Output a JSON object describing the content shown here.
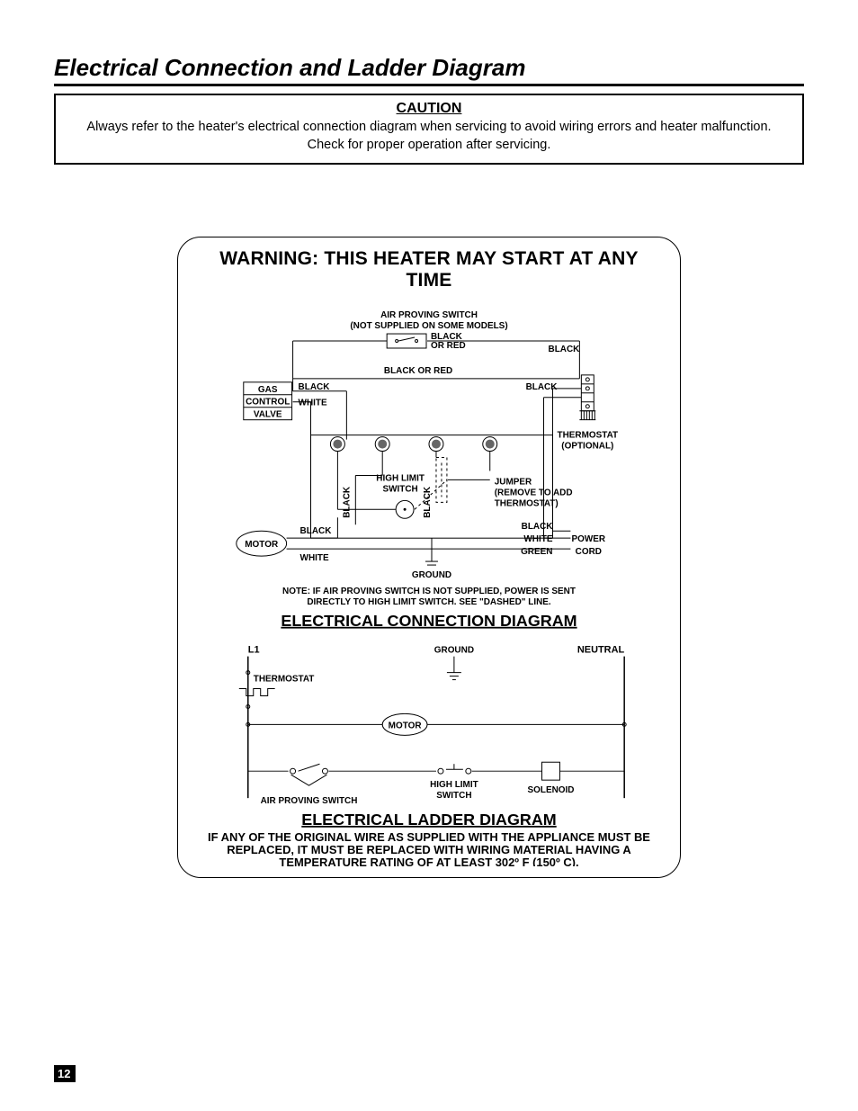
{
  "page_title": "Electrical Connection and Ladder Diagram",
  "caution": {
    "title": "CAUTION",
    "text": "Always refer to the heater's electrical connection diagram when servicing to avoid wiring errors and heater malfunction. Check for proper operation after servicing."
  },
  "warning": "WARNING:  THIS HEATER MAY START AT ANY TIME",
  "labels": {
    "air_proving_switch": "AIR PROVING SWITCH",
    "not_supplied": "(NOT SUPPLIED ON SOME MODELS)",
    "black_or_red": "BLACK OR RED",
    "black": "BLACK",
    "white": "WHITE",
    "green": "GREEN",
    "gas_control_valve_1": "GAS",
    "gas_control_valve_2": "CONTROL",
    "gas_control_valve_3": "VALVE",
    "high_limit_switch_1": "HIGH LIMIT",
    "high_limit_switch_2": "SWITCH",
    "jumper": "JUMPER",
    "jumper_note_1": "(REMOVE TO ADD",
    "jumper_note_2": "THERMOSTAT)",
    "thermostat": "THERMOSTAT",
    "optional": "(OPTIONAL)",
    "motor": "MOTOR",
    "power_cord_1": "POWER",
    "power_cord_2": "CORD",
    "ground": "GROUND",
    "l1": "L1",
    "neutral": "NEUTRAL",
    "solenoid": "SOLENOID",
    "air_proving_switch_2": "AIR PROVING SWITCH"
  },
  "note_line1": "NOTE:  IF AIR PROVING SWITCH IS NOT SUPPLIED, POWER IS SENT",
  "note_line2": "DIRECTLY TO HIGH LIMIT SWITCH.  SEE \"DASHED\" LINE.",
  "section1_title": "ELECTRICAL CONNECTION DIAGRAM",
  "section2_title": "ELECTRICAL LADDER DIAGRAM",
  "wire_note_line1": "IF ANY OF THE ORIGINAL WIRE AS SUPPLIED WITH THE APPLIANCE MUST BE",
  "wire_note_line2": "REPLACED, IT MUST BE REPLACED WITH WIRING MATERIAL HAVING A",
  "wire_note_line3": "TEMPERATURE RATING OF AT LEAST 302º F (150º C).",
  "page_number": "12"
}
